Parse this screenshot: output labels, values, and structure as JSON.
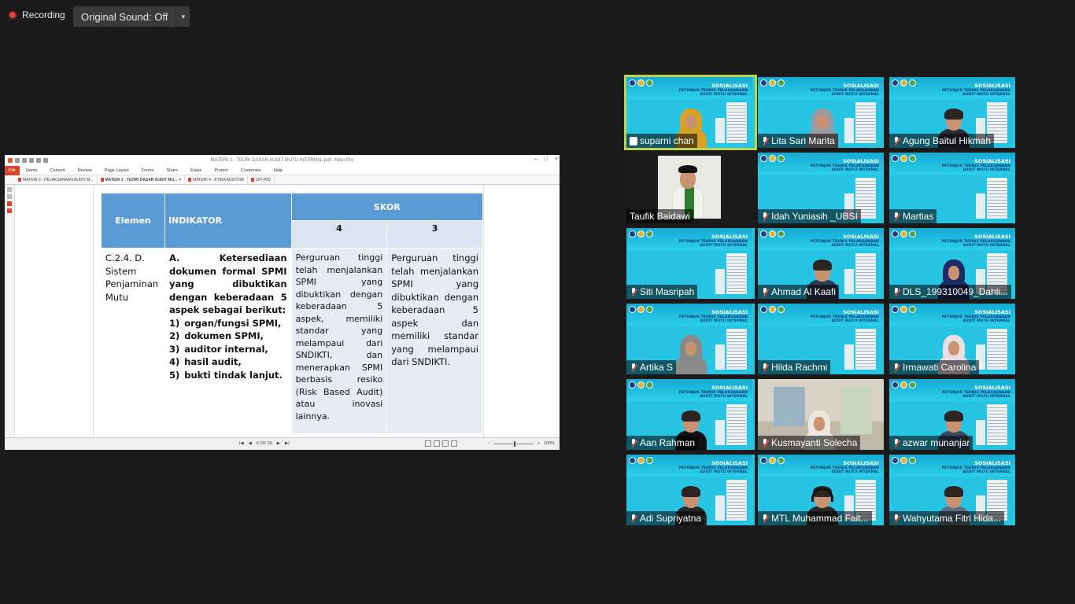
{
  "recording": {
    "label": "Recording"
  },
  "original_sound": {
    "label": "Original Sound: Off"
  },
  "nitro": {
    "window_title": "MATERI 1 - TEORI DASAR AUDIT MUTU INTERNAL.pdf - Nitro Pro",
    "menu": [
      "File",
      "Home",
      "Convert",
      "Review",
      "Page Layout",
      "Forms",
      "Share",
      "Erase",
      "Protect",
      "Customize",
      "Help"
    ],
    "tabs": [
      {
        "label": "MATERI 3 - PELAKSANAAN AUDIT M..."
      },
      {
        "label": "MATERI 1 - TEORI DASAR AUDIT MU..."
      },
      {
        "label": "MATERI 4 - ETIKA AUDITOR"
      },
      {
        "label": "207-P09"
      }
    ],
    "page_indicator": "6 OF 28",
    "zoom": "100%"
  },
  "doc_table": {
    "col_elemen": "Elemen",
    "col_indikator": "INDIKATOR",
    "col_skor": "SKOR",
    "skor_4": "4",
    "skor_3": "3",
    "elemen_text": "C.2.4. D. Sistem Penjaminan Mutu",
    "indikator_intro": "A. Ketersediaan dokumen formal SPMI yang dibuktikan dengan keberadaan 5 aspek sebagai berikut:",
    "indikator_items": [
      {
        "num": "1)",
        "text": "organ/fungsi SPMI,"
      },
      {
        "num": "2)",
        "text": "dokumen SPMI,"
      },
      {
        "num": "3)",
        "text": "auditor internal,"
      },
      {
        "num": "4)",
        "text": "hasil audit,"
      },
      {
        "num": "5)",
        "text": "bukti tindak lanjut."
      }
    ],
    "skor_4_text": "Perguruan tinggi telah menjalankan SPMI yang dibuktikan dengan keberadaan 5 aspek, memiliki standar yang melampaui dari SNDIKTI, dan menerapkan SPMI berbasis resiko (Risk Based Audit) atau inovasi lainnya.",
    "skor_3_text": "Perguruan tinggi telah menjalankan SPMI yang dibuktikan dengan keberadaan 5 aspek dan memiliki standar yang melampaui dari SNDIKTI."
  },
  "banner": {
    "title": "SOSIALISASI",
    "sub1": "PETUNJUK TEKNIS PELAKSANAAN",
    "sub2": "AUDIT MUTU INTERNAL"
  },
  "participants": [
    {
      "name": "suparni chan"
    },
    {
      "name": "Lita Sari Marita"
    },
    {
      "name": "Agung Baitul Hikmah"
    },
    {
      "name": "Taufik Baidawi"
    },
    {
      "name": "Idah Yuniasih _UBSI"
    },
    {
      "name": "Martias"
    },
    {
      "name": "Siti Masripah"
    },
    {
      "name": "Ahmad Al Kaafi"
    },
    {
      "name": "DLS_199310049_Dahli..."
    },
    {
      "name": "Artika S"
    },
    {
      "name": "Hilda Rachmi"
    },
    {
      "name": "Irmawati Carolina"
    },
    {
      "name": "Aan Rahman"
    },
    {
      "name": "Kusmayanti Solecha"
    },
    {
      "name": "azwar munanjar"
    },
    {
      "name": "Adi Supriyatna"
    },
    {
      "name": "MTL Muhammad Fait..."
    },
    {
      "name": "Wahyutama Fitri Hida..."
    }
  ],
  "colors": {
    "accent_active": "#b9d64a",
    "bg": "#1a1a1a",
    "table_header": "#5b9bd5",
    "banner": "#27c4e4"
  }
}
